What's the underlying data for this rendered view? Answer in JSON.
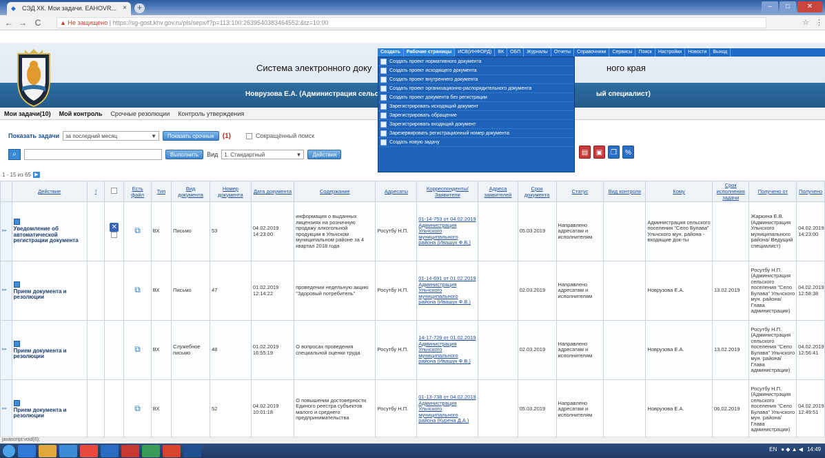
{
  "browser": {
    "tab_title": "СЭД ХК. Мои задачи. ЕАНОVR...",
    "tab_close": "×",
    "new_tab": "+",
    "url_warning": "Не защищено",
    "url": "https://sg-gost.khv.gov.ru/pls/sepx/f?p=113:100:2639540383464552:&tz=10:00",
    "win_min": "–",
    "win_max": "□",
    "win_close": "✕",
    "nav_back": "←",
    "nav_forward": "→",
    "nav_reload": "C",
    "star": "☆",
    "menu": "⋮",
    "account": "Θ"
  },
  "header": {
    "system_title": "Система электронного доку",
    "system_title_end": "ного края",
    "user": "Новрузова Е.А. (Администрация сельско",
    "user_end": "ый специалист)"
  },
  "top_menu": [
    "Создать",
    "Рабочие страницы",
    "ИСВ(ИНФОРД)",
    "ВК",
    "ОБП",
    "Журналы",
    "Отчеты",
    "Справочники",
    "Сервисы",
    "Поиск",
    "Настройки",
    "Новости",
    "Выход"
  ],
  "dropdown": [
    "Создать проект нормативного документа",
    "Создать проект исходящего документа",
    "Создать проект внутреннего документа",
    "Создать проект организационно-распорядительного документа",
    "Создать проект документа без регистрации",
    "Зарегистрировать исходящий документ",
    "Зарегистрировать обращение",
    "Зарегистрировать входящий документ",
    "Зарезервировать регистрационный номер документа",
    "Создать новую задачу"
  ],
  "tabs": [
    "Мои задачи(10)",
    "Мой контроль",
    "Срочные резолюции",
    "Контроль утверждения"
  ],
  "filter": {
    "show_label": "Показать задачи",
    "period": "за последний месяц",
    "urgent_btn": "Показать срочные",
    "urgent_count": "(1)",
    "short_search": "Сокращённый поиск",
    "run_btn": "Выполнить",
    "view_label": "Вид",
    "view_value": "1. Стандартный",
    "action_btn": "Действия"
  },
  "paging": "1 - 15 из 65",
  "columns": [
    "Действие",
    "!",
    "",
    "Есть файл",
    "Тип",
    "Вид документа",
    "Номер документа",
    "Дата документа",
    "Содержание",
    "Адресаты",
    "Корреспонденты/ Заявители",
    "Адреса заявителей",
    "Срок документа",
    "Статус",
    "Вид контроля",
    "Кому",
    "Срок исполнения задачи",
    "Получено от",
    "Получено"
  ],
  "rows": [
    {
      "action": "Уведомление об автоматической регистрации документа",
      "type": "ВХ",
      "kind": "Письмо",
      "number": "53",
      "date": "04.02.2019 14:23:00",
      "content": "информация о выданных лицензиях на розничную продажу алкогольной продукции в Ульчском муниципальном районе за 4 квартал 2018 года",
      "addressee": "Росутбу Н.П.",
      "corr": "01-14-753 от 04.02.2019 Администрация Ульчского муниципального района (Ивашук Ф.В.)",
      "due": "05.03.2019",
      "status": "Направлено адресатам и исполнителям",
      "to": "Администрация сельского поселения \"Село Булава\" Ульчского мун. района - входящие док-ты",
      "task_due": "",
      "from": "Жаркина Е.В. (Администрация Ульчского муниципального района/ Ведущий специалист)",
      "received": "04.02.2019 14:23:00"
    },
    {
      "action": "Прием документа и резолюции",
      "type": "ВХ",
      "kind": "Письмо",
      "number": "47",
      "date": "01.02.2019 12:14:22",
      "content": "проведении недельную акцию \"Здоровый потребитель\"",
      "addressee": "Росутбу Н.П.",
      "corr": "01-14-691 от 01.02.2019 Администрация Ульчского муниципального района (Ивашук Ф.В.)",
      "due": "02.03.2019",
      "status": "Направлено адресатам и исполнителям",
      "to": "Новрузова Е.А.",
      "task_due": "13.02.2019",
      "from": "Росутбу Н.П. (Администрация сельского поселения \"Село Булава\" Ульчского мун. района/Глава администрации)",
      "received": "04.02.2019 12:58:38"
    },
    {
      "action": "Прием документа и резолюции",
      "type": "ВХ",
      "kind": "Служебное письмо",
      "number": "48",
      "date": "01.02.2019 16:55:19",
      "content": "О вопросах проведения специальной оценки труда",
      "addressee": "Росутбу Н.П.",
      "corr": "14-17-729 от 01.02.2019 Администрация Ульчского муниципального района (Ивашук Ф.В.)",
      "due": "02.03.2019",
      "status": "Направлено адресатам и исполнителям",
      "to": "Новрузова Е.А.",
      "task_due": "13.02.2019",
      "from": "Росутбу Н.П. (Администрация сельского поселения \"Село Булава\" Ульчского мун. района/Глава администрации)",
      "received": "04.02.2019 12:56:41"
    },
    {
      "action": "Прием документа и резолюции",
      "type": "ВХ",
      "kind": "",
      "number": "52",
      "date": "04.02.2019 10:01:18",
      "content": "О повышении достоверности Единого реестра субъектов малого и среднего предпринимательства",
      "addressee": "Росутбу Н.П.",
      "corr": "01-13-738 от 04.02.2019 Администрация Ульчского муниципального района (Курена Д.А.)",
      "due": "05.03.2019",
      "status": "Направлено адресатам и исполнителям",
      "to": "Новрузова Е.А.",
      "task_due": "06.02.2019",
      "from": "Росутбу Н.П. (Администрация сельского поселения \"Село Булава\" Ульчского мун. района/Глава администрации)",
      "received": "04.02.2019 12:49:51"
    }
  ],
  "status_bar": "javascript:void(0);",
  "tray": {
    "lang": "EN",
    "time": "14:49"
  }
}
